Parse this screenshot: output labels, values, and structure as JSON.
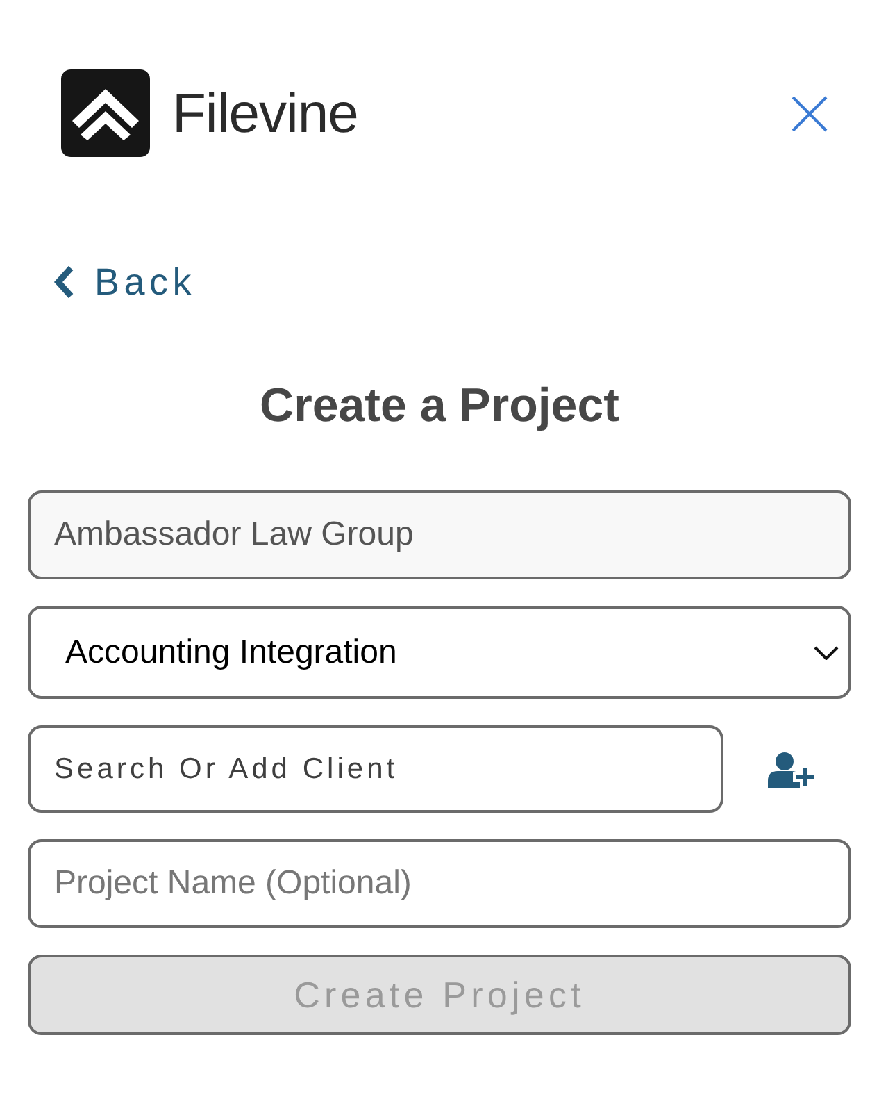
{
  "header": {
    "brand": "Filevine"
  },
  "back_link": {
    "label": "Back"
  },
  "title": "Create a Project",
  "form": {
    "organization": {
      "value": "Ambassador Law Group",
      "disabled": true
    },
    "project_type": {
      "value": "Accounting Integration"
    },
    "client": {
      "placeholder": "Search Or Add Client"
    },
    "project_name": {
      "placeholder": "Project Name (Optional)"
    },
    "submit": {
      "label": "Create Project",
      "disabled": true
    }
  }
}
